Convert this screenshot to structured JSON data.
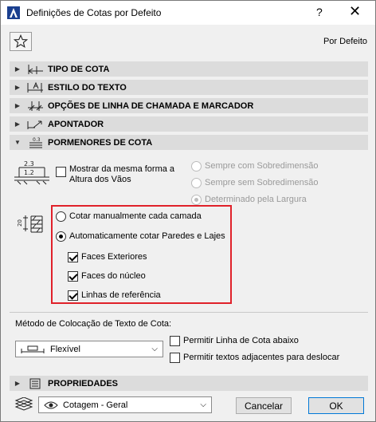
{
  "window": {
    "title": "Definições de Cotas por Defeito",
    "help_glyph": "?",
    "close_glyph": "✕"
  },
  "header": {
    "default_label": "Por Defeito"
  },
  "sections": {
    "tipo_cota": "TIPO DE COTA",
    "estilo_texto": "ESTILO DO TEXTO",
    "opcoes_chamada": "OPÇÕES DE LINHA DE CHAMADA E MARCADOR",
    "apontador": "APONTADOR",
    "pormenores": "PORMENORES DE COTA",
    "propriedades": "PROPRIEDADES"
  },
  "pormenores": {
    "icon_top": "2.3",
    "icon_bottom": "1.2",
    "mostrar_line1": "Mostrar da mesma forma a",
    "mostrar_line2": "Altura dos Vãos",
    "mostrar_checked": false,
    "sobredim_options": [
      {
        "label": "Sempre com Sobredimensão",
        "checked": false,
        "enabled": false
      },
      {
        "label": "Sempre sem Sobredimensão",
        "checked": false,
        "enabled": false
      },
      {
        "label": "Determinado pela Largura",
        "checked": true,
        "enabled": false
      }
    ],
    "layer_icon_text": "20",
    "cotar_manual": "Cotar manualmente cada camada",
    "cotar_auto": "Automaticamente cotar Paredes e Lajes",
    "selected_mode": "auto",
    "faces_exteriores": "Faces Exteriores",
    "faces_nucleo": "Faces do núcleo",
    "linhas_referencia": "Linhas de referência"
  },
  "texto_cota": {
    "metodo_label": "Método de Colocação de Texto de Cota:",
    "metodo_value": "Flexível",
    "permitir_linha": "Permitir Linha de Cota abaixo",
    "permitir_textos": "Permitir textos adjacentes para deslocar"
  },
  "footer": {
    "layer_value": "Cotagem - Geral",
    "cancel_label": "Cancelar",
    "ok_label": "OK"
  },
  "colors": {
    "highlight_border": "#e0212a",
    "section_bg": "#dcdcdc",
    "ok_border": "#0078d7"
  }
}
